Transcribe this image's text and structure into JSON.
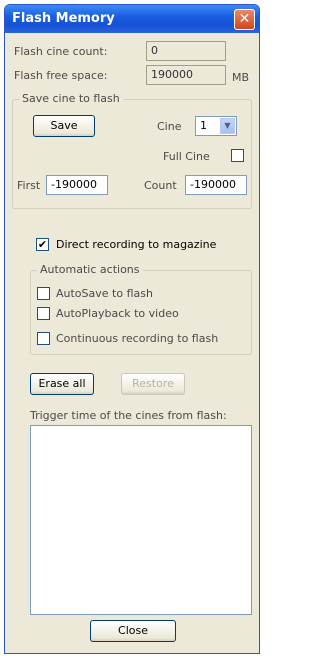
{
  "window": {
    "title": "Flash Memory",
    "close_glyph": "✕"
  },
  "info": {
    "cine_count_label": "Flash cine count:",
    "cine_count_value": "0",
    "free_space_label": "Flash free space:",
    "free_space_value": "190000",
    "free_space_unit": "MB"
  },
  "save_group": {
    "title": "Save cine to flash",
    "save_label": "Save",
    "cine_label": "Cine",
    "cine_value": "1",
    "full_cine_label": "Full Cine",
    "full_cine_checked": false,
    "first_label": "First",
    "first_value": "-190000",
    "count_label": "Count",
    "count_value": "-190000"
  },
  "direct_recording": {
    "label": "Direct recording to magazine",
    "checked": true
  },
  "auto_group": {
    "title": "Automatic actions",
    "items": [
      {
        "label": "AutoSave to flash",
        "checked": false
      },
      {
        "label": "AutoPlayback to video",
        "checked": false
      },
      {
        "label": "Continuous recording to flash",
        "checked": false
      }
    ]
  },
  "actions": {
    "erase_label": "Erase all",
    "restore_label": "Restore"
  },
  "trigger": {
    "label": "Trigger time of the cines from flash:",
    "items": []
  },
  "footer": {
    "close_label": "Close"
  },
  "icons": {
    "check": "✔",
    "dropdown": "▼"
  }
}
